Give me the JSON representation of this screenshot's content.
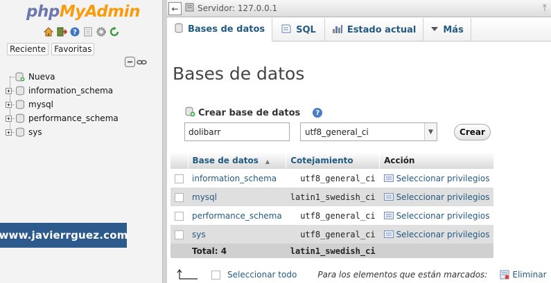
{
  "app": {
    "logo_php": "php",
    "logo_myadmin": "MyAdmin"
  },
  "nav": {
    "tabs": [
      "Reciente",
      "Favoritas"
    ],
    "tree": [
      {
        "label": "Nueva",
        "type": "new"
      },
      {
        "label": "information_schema",
        "type": "db"
      },
      {
        "label": "mysql",
        "type": "db"
      },
      {
        "label": "performance_schema",
        "type": "db"
      },
      {
        "label": "sys",
        "type": "db"
      }
    ]
  },
  "watermark": "www.javierrguez.com",
  "topbar": {
    "server": "Servidor: 127.0.0.1"
  },
  "tabs": [
    {
      "label": "Bases de datos",
      "icon": "database-icon",
      "active": true
    },
    {
      "label": "SQL",
      "icon": "sql-icon",
      "active": false
    },
    {
      "label": "Estado actual",
      "icon": "status-icon",
      "active": false
    },
    {
      "label": "Más",
      "icon": "chevron-down-icon",
      "active": false
    }
  ],
  "page": {
    "title": "Bases de datos"
  },
  "create": {
    "heading": "Crear base de datos",
    "name_value": "dolibarr",
    "collation_value": "utf8_general_ci",
    "button": "Crear"
  },
  "table": {
    "headers": [
      "Base de datos",
      "Cotejamiento",
      "Acción"
    ],
    "rows": [
      {
        "name": "information_schema",
        "collation": "utf8_general_ci",
        "action": "Seleccionar privilegios"
      },
      {
        "name": "mysql",
        "collation": "latin1_swedish_ci",
        "action": "Seleccionar privilegios"
      },
      {
        "name": "performance_schema",
        "collation": "utf8_general_ci",
        "action": "Seleccionar privilegios"
      },
      {
        "name": "sys",
        "collation": "utf8_general_ci",
        "action": "Seleccionar privilegios"
      }
    ],
    "total_label": "Total: 4",
    "total_collation": "latin1_swedish_ci"
  },
  "footer": {
    "select_all": "Seleccionar todo",
    "marked_label": "Para los elementos que están marcados:",
    "delete": "Eliminar"
  },
  "colors": {
    "link": "#235a81",
    "logo_php": "#6c78af",
    "logo_myadmin": "#f89c0e",
    "watermark_bg": "#2d5a8c"
  }
}
